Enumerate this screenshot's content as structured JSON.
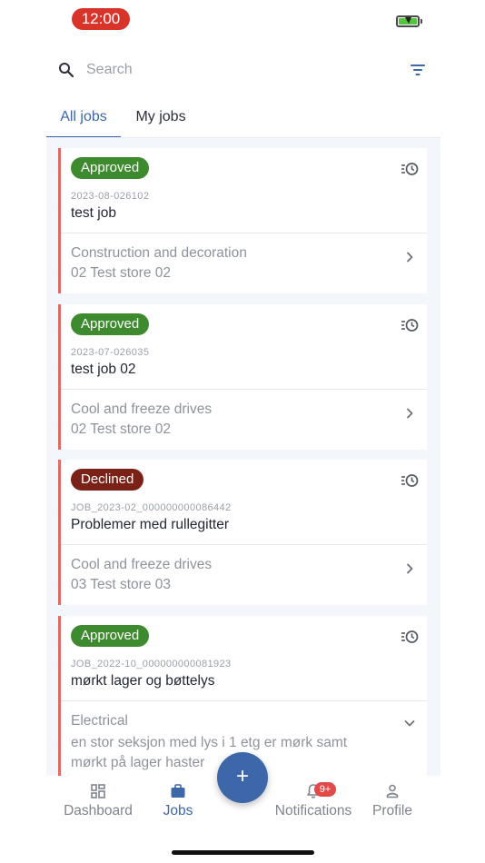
{
  "status_bar": {
    "time": "12:00"
  },
  "search": {
    "placeholder": "Search"
  },
  "tabs": [
    {
      "label": "All jobs",
      "active": true
    },
    {
      "label": "My jobs",
      "active": false
    }
  ],
  "jobs": [
    {
      "status": "Approved",
      "id": "2023-08-026102",
      "title": "test job",
      "category": "Construction and decoration",
      "store": "02 Test store 02",
      "expanded": false
    },
    {
      "status": "Approved",
      "id": "2023-07-026035",
      "title": "test job 02",
      "category": "Cool and freeze drives",
      "store": "02 Test store 02",
      "expanded": false
    },
    {
      "status": "Declined",
      "id": "JOB_2023-02_000000000086442",
      "title": "Problemer med rullegitter",
      "category": "Cool and freeze drives",
      "store": "03 Test store 03",
      "expanded": false
    },
    {
      "status": "Approved",
      "id": "JOB_2022-10_000000000081923",
      "title": "mørkt lager og bøttelys",
      "category": "Electrical",
      "description": "en stor seksjon med lys i 1 etg er mørk samt mørkt på lager  haster",
      "expanded": true
    }
  ],
  "fab": {
    "label": "+"
  },
  "bottom_nav": {
    "dashboard": "Dashboard",
    "jobs": "Jobs",
    "notifications": "Notifications",
    "notifications_badge": "9+",
    "profile": "Profile"
  },
  "colors": {
    "accent": "#3d67a8",
    "approved": "#3e8a2e",
    "declined": "#7a2217",
    "card_stripe": "#e06a64",
    "status_time_bg": "#d8342a"
  }
}
